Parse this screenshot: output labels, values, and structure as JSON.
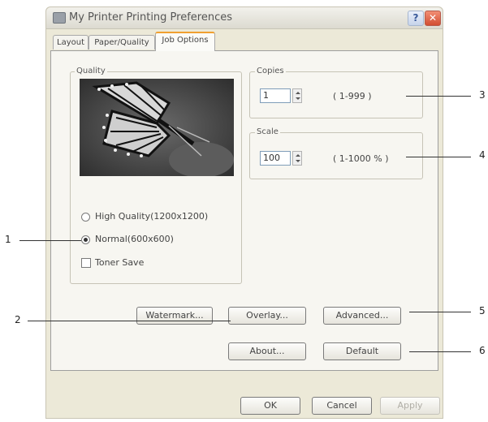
{
  "window": {
    "title": "My Printer Printing Preferences",
    "help_label": "?",
    "close_label": "✕"
  },
  "tabs": [
    {
      "label": "Layout"
    },
    {
      "label": "Paper/Quality"
    },
    {
      "label": "Job Options"
    }
  ],
  "quality": {
    "group_label": "Quality",
    "options": [
      {
        "label": "High Quality(1200x1200)",
        "selected": false
      },
      {
        "label": "Normal(600x600)",
        "selected": true
      }
    ],
    "toner_save": {
      "label": "Toner Save",
      "checked": false
    }
  },
  "copies": {
    "group_label": "Copies",
    "value": "1",
    "range": "( 1-999 )"
  },
  "scale": {
    "group_label": "Scale",
    "value": "100",
    "range": "( 1-1000 % )"
  },
  "buttons": {
    "watermark": "Watermark...",
    "overlay": "Overlay...",
    "advanced": "Advanced...",
    "about": "About...",
    "default": "Default",
    "ok": "OK",
    "cancel": "Cancel",
    "apply": "Apply"
  },
  "callouts": [
    "1",
    "2",
    "3",
    "4",
    "5",
    "6"
  ]
}
